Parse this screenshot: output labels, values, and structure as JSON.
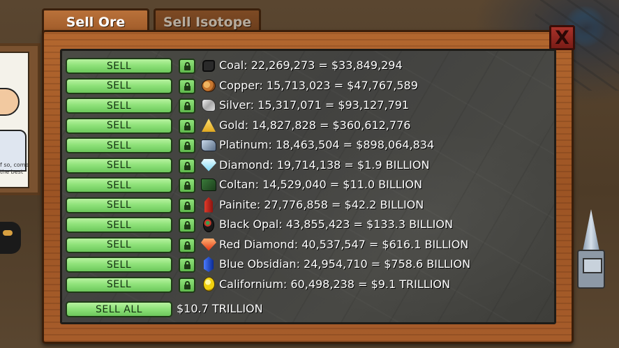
{
  "tabs": [
    {
      "label": "Sell Ore",
      "active": true
    },
    {
      "label": "Sell Isotope",
      "active": false
    }
  ],
  "close_label": "X",
  "sell_label": "SELL",
  "sell_all_label": "SELL ALL",
  "total_value": "$10.7 TRILLION",
  "portrait_caption": "f so, come the best",
  "ores": [
    {
      "name": "Coal",
      "icon": "coal-icon",
      "text": "Coal: 22,269,273 = $33,849,294"
    },
    {
      "name": "Copper",
      "icon": "copper-icon",
      "text": "Copper: 15,713,023 = $47,767,589"
    },
    {
      "name": "Silver",
      "icon": "silver-icon",
      "text": "Silver: 15,317,071 = $93,127,791"
    },
    {
      "name": "Gold",
      "icon": "gold-icon",
      "text": "Gold: 14,827,828 = $360,612,776"
    },
    {
      "name": "Platinum",
      "icon": "platinum-icon",
      "text": "Platinum: 18,463,504 = $898,064,834"
    },
    {
      "name": "Diamond",
      "icon": "diamond-icon",
      "text": "Diamond: 19,714,138 = $1.9 BILLION"
    },
    {
      "name": "Coltan",
      "icon": "coltan-icon",
      "text": "Coltan: 14,529,040 = $11.0 BILLION"
    },
    {
      "name": "Painite",
      "icon": "painite-icon",
      "text": "Painite: 27,776,858 = $42.2 BILLION"
    },
    {
      "name": "Black Opal",
      "icon": "black-opal-icon",
      "text": "Black Opal: 43,855,423 = $133.3 BILLION"
    },
    {
      "name": "Red Diamond",
      "icon": "red-diamond-icon",
      "text": "Red Diamond: 40,537,547 = $616.1 BILLION"
    },
    {
      "name": "Blue Obsidian",
      "icon": "blue-obsidian-icon",
      "text": "Blue Obsidian: 24,954,710 = $758.6 BILLION"
    },
    {
      "name": "Californium",
      "icon": "californium-icon",
      "text": "Californium: 60,498,238 = $9.1 TRILLION"
    }
  ],
  "colors": {
    "sell_button": "#8fe27a",
    "frame_wood": "#a65c2a",
    "close_button": "#a8322a",
    "panel_stone": "#444440"
  }
}
